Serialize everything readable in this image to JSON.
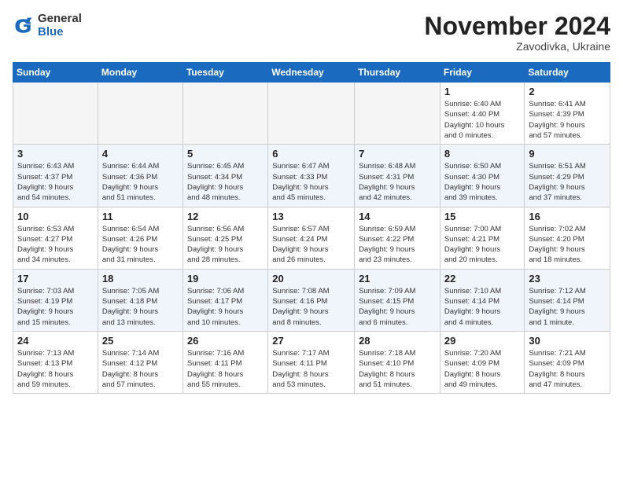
{
  "header": {
    "logo_general": "General",
    "logo_blue": "Blue",
    "month_title": "November 2024",
    "location": "Zavodivka, Ukraine"
  },
  "days_of_week": [
    "Sunday",
    "Monday",
    "Tuesday",
    "Wednesday",
    "Thursday",
    "Friday",
    "Saturday"
  ],
  "weeks": [
    [
      {
        "day": "",
        "info": ""
      },
      {
        "day": "",
        "info": ""
      },
      {
        "day": "",
        "info": ""
      },
      {
        "day": "",
        "info": ""
      },
      {
        "day": "",
        "info": ""
      },
      {
        "day": "1",
        "info": "Sunrise: 6:40 AM\nSunset: 4:40 PM\nDaylight: 10 hours\nand 0 minutes."
      },
      {
        "day": "2",
        "info": "Sunrise: 6:41 AM\nSunset: 4:39 PM\nDaylight: 9 hours\nand 57 minutes."
      }
    ],
    [
      {
        "day": "3",
        "info": "Sunrise: 6:43 AM\nSunset: 4:37 PM\nDaylight: 9 hours\nand 54 minutes."
      },
      {
        "day": "4",
        "info": "Sunrise: 6:44 AM\nSunset: 4:36 PM\nDaylight: 9 hours\nand 51 minutes."
      },
      {
        "day": "5",
        "info": "Sunrise: 6:45 AM\nSunset: 4:34 PM\nDaylight: 9 hours\nand 48 minutes."
      },
      {
        "day": "6",
        "info": "Sunrise: 6:47 AM\nSunset: 4:33 PM\nDaylight: 9 hours\nand 45 minutes."
      },
      {
        "day": "7",
        "info": "Sunrise: 6:48 AM\nSunset: 4:31 PM\nDaylight: 9 hours\nand 42 minutes."
      },
      {
        "day": "8",
        "info": "Sunrise: 6:50 AM\nSunset: 4:30 PM\nDaylight: 9 hours\nand 39 minutes."
      },
      {
        "day": "9",
        "info": "Sunrise: 6:51 AM\nSunset: 4:29 PM\nDaylight: 9 hours\nand 37 minutes."
      }
    ],
    [
      {
        "day": "10",
        "info": "Sunrise: 6:53 AM\nSunset: 4:27 PM\nDaylight: 9 hours\nand 34 minutes."
      },
      {
        "day": "11",
        "info": "Sunrise: 6:54 AM\nSunset: 4:26 PM\nDaylight: 9 hours\nand 31 minutes."
      },
      {
        "day": "12",
        "info": "Sunrise: 6:56 AM\nSunset: 4:25 PM\nDaylight: 9 hours\nand 28 minutes."
      },
      {
        "day": "13",
        "info": "Sunrise: 6:57 AM\nSunset: 4:24 PM\nDaylight: 9 hours\nand 26 minutes."
      },
      {
        "day": "14",
        "info": "Sunrise: 6:59 AM\nSunset: 4:22 PM\nDaylight: 9 hours\nand 23 minutes."
      },
      {
        "day": "15",
        "info": "Sunrise: 7:00 AM\nSunset: 4:21 PM\nDaylight: 9 hours\nand 20 minutes."
      },
      {
        "day": "16",
        "info": "Sunrise: 7:02 AM\nSunset: 4:20 PM\nDaylight: 9 hours\nand 18 minutes."
      }
    ],
    [
      {
        "day": "17",
        "info": "Sunrise: 7:03 AM\nSunset: 4:19 PM\nDaylight: 9 hours\nand 15 minutes."
      },
      {
        "day": "18",
        "info": "Sunrise: 7:05 AM\nSunset: 4:18 PM\nDaylight: 9 hours\nand 13 minutes."
      },
      {
        "day": "19",
        "info": "Sunrise: 7:06 AM\nSunset: 4:17 PM\nDaylight: 9 hours\nand 10 minutes."
      },
      {
        "day": "20",
        "info": "Sunrise: 7:08 AM\nSunset: 4:16 PM\nDaylight: 9 hours\nand 8 minutes."
      },
      {
        "day": "21",
        "info": "Sunrise: 7:09 AM\nSunset: 4:15 PM\nDaylight: 9 hours\nand 6 minutes."
      },
      {
        "day": "22",
        "info": "Sunrise: 7:10 AM\nSunset: 4:14 PM\nDaylight: 9 hours\nand 4 minutes."
      },
      {
        "day": "23",
        "info": "Sunrise: 7:12 AM\nSunset: 4:14 PM\nDaylight: 9 hours\nand 1 minute."
      }
    ],
    [
      {
        "day": "24",
        "info": "Sunrise: 7:13 AM\nSunset: 4:13 PM\nDaylight: 8 hours\nand 59 minutes."
      },
      {
        "day": "25",
        "info": "Sunrise: 7:14 AM\nSunset: 4:12 PM\nDaylight: 8 hours\nand 57 minutes."
      },
      {
        "day": "26",
        "info": "Sunrise: 7:16 AM\nSunset: 4:11 PM\nDaylight: 8 hours\nand 55 minutes."
      },
      {
        "day": "27",
        "info": "Sunrise: 7:17 AM\nSunset: 4:11 PM\nDaylight: 8 hours\nand 53 minutes."
      },
      {
        "day": "28",
        "info": "Sunrise: 7:18 AM\nSunset: 4:10 PM\nDaylight: 8 hours\nand 51 minutes."
      },
      {
        "day": "29",
        "info": "Sunrise: 7:20 AM\nSunset: 4:09 PM\nDaylight: 8 hours\nand 49 minutes."
      },
      {
        "day": "30",
        "info": "Sunrise: 7:21 AM\nSunset: 4:09 PM\nDaylight: 8 hours\nand 47 minutes."
      }
    ]
  ]
}
